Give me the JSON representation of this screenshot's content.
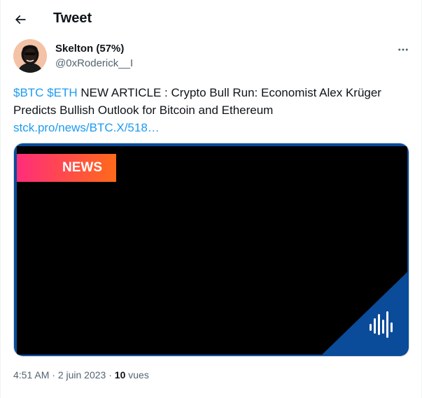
{
  "header": {
    "title": "Tweet"
  },
  "author": {
    "display_name": "Skelton (57%)",
    "handle": "@0xRoderick__I"
  },
  "tweet": {
    "cashtag_1": "$BTC",
    "cashtag_2": "$ETH",
    "text": "NEW ARTICLE : Crypto Bull Run: Economist Alex Krüger Predicts Bullish Outlook for Bitcoin and Ethereum",
    "link": "stck.pro/news/BTC.X/518…"
  },
  "media": {
    "badge_text": "NEWS"
  },
  "meta": {
    "time": "4:51 AM",
    "separator": "·",
    "date": "2 juin 2023",
    "views_count": "10",
    "views_label": "vues"
  },
  "icons": {
    "back": "arrow-left-icon",
    "more": "more-horizontal-icon",
    "logo": "waveform-logo-icon"
  },
  "colors": {
    "link": "#1d9bf0",
    "media_bg": "#000000",
    "corner": "#0a4b9a",
    "badge_start": "#ff2d7a",
    "badge_end": "#ff6a1a"
  }
}
